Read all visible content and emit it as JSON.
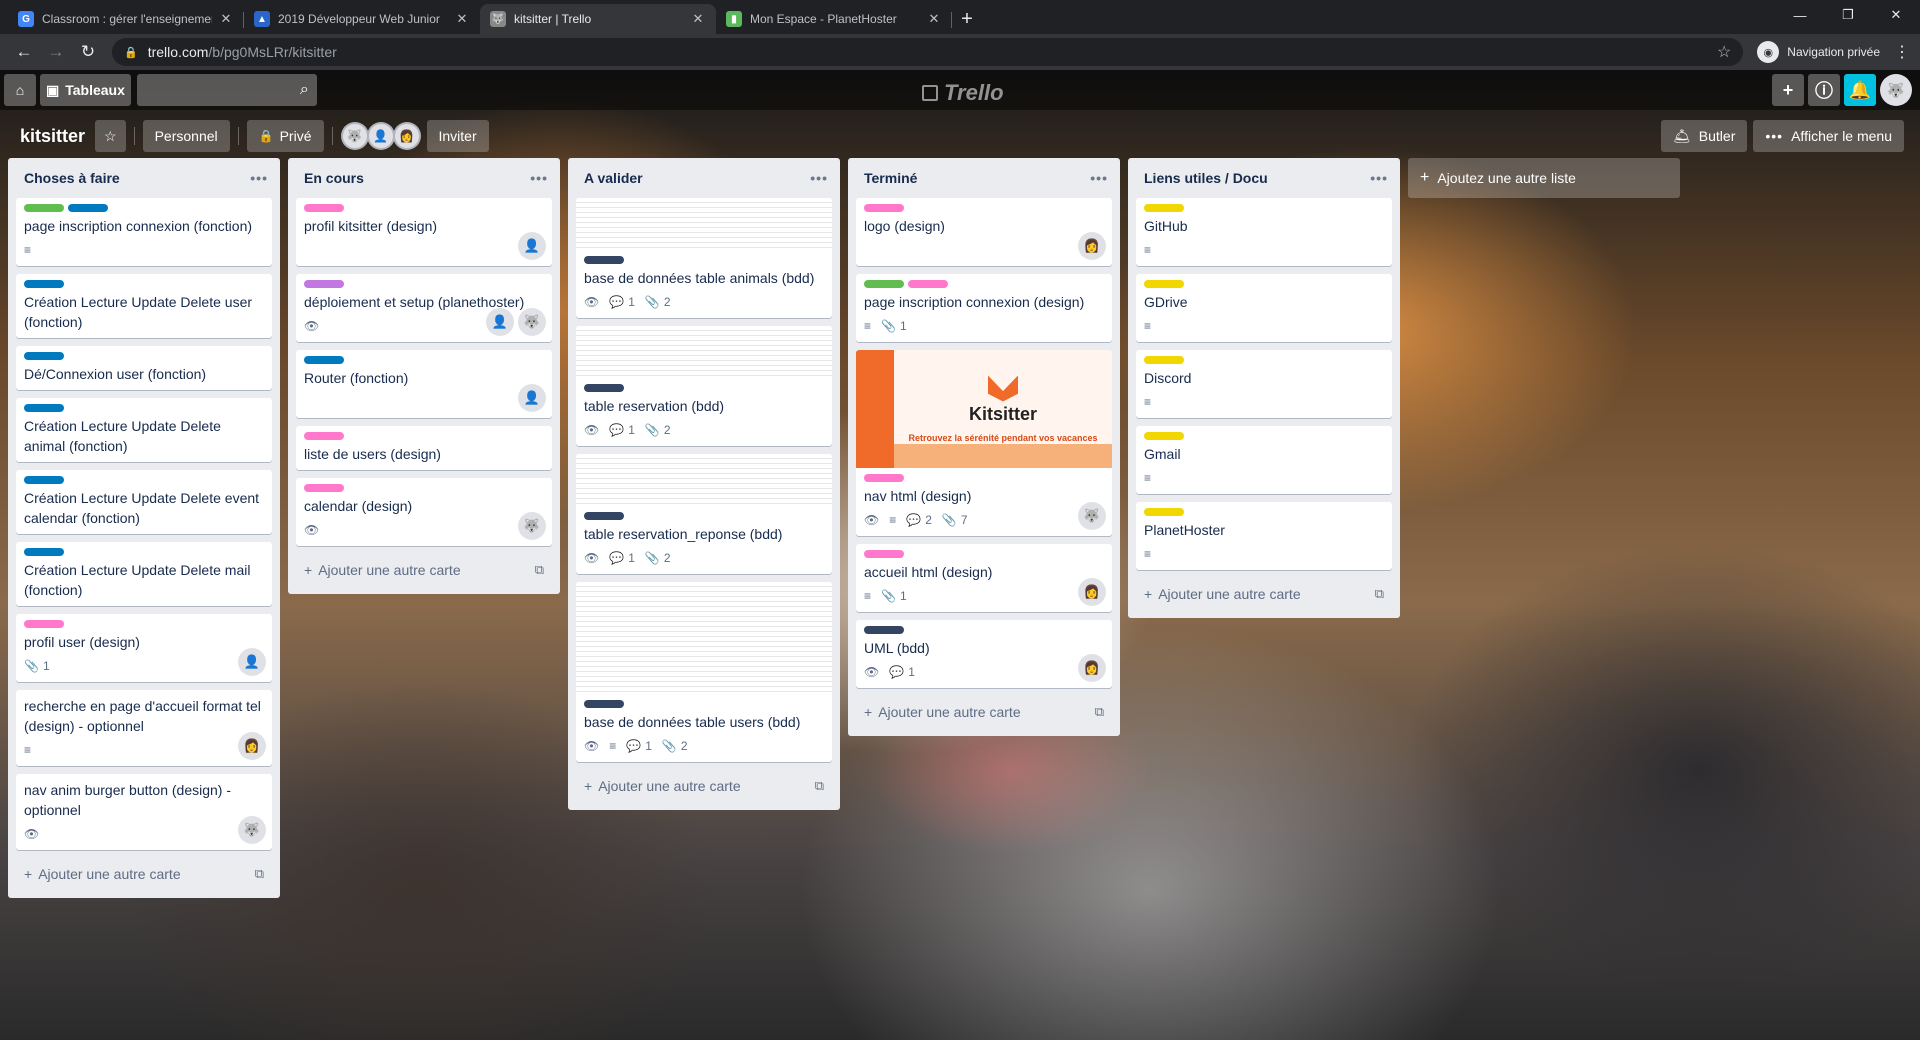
{
  "browser": {
    "tabs": [
      {
        "title": "Classroom : gérer l'enseignement",
        "favicon": "G",
        "color": "#4285f4"
      },
      {
        "title": "2019 Développeur Web Junior",
        "favicon": "▲",
        "color": "#2a66c9"
      },
      {
        "title": "kitsitter | Trello",
        "favicon": "🐺",
        "color": "#888888"
      },
      {
        "title": "Mon Espace - PlanetHoster",
        "favicon": "▮",
        "color": "#5cb85c"
      }
    ],
    "url_host": "trello.com",
    "url_path": "/b/pg0MsLRr/kitsitter",
    "profile_label": "Navigation privée"
  },
  "trello_header": {
    "boards_label": "Tableaux",
    "logo": "Trello"
  },
  "board": {
    "title": "kitsitter",
    "team_label": "Personnel",
    "visibility_label": "Privé",
    "invite_label": "Inviter",
    "butler_label": "Butler",
    "menu_label": "Afficher le menu",
    "add_list_label": "Ajoutez une autre liste",
    "add_card_label": "Ajouter une autre carte"
  },
  "lists": [
    {
      "title": "Choses à faire",
      "cards": [
        {
          "title": "page inscription connexion (fonction)",
          "labels": [
            "green",
            "blue"
          ],
          "desc": true
        },
        {
          "title": "Création Lecture Update Delete user (fonction)",
          "labels": [
            "blue"
          ]
        },
        {
          "title": "Dé/Connexion user (fonction)",
          "labels": [
            "blue"
          ]
        },
        {
          "title": "Création Lecture Update Delete animal (fonction)",
          "labels": [
            "blue"
          ]
        },
        {
          "title": "Création Lecture Update Delete event calendar (fonction)",
          "labels": [
            "blue"
          ]
        },
        {
          "title": "Création Lecture Update Delete mail (fonction)",
          "labels": [
            "blue"
          ]
        },
        {
          "title": "profil user (design)",
          "labels": [
            "pink"
          ],
          "attach": "1",
          "avatar": "👤"
        },
        {
          "title": "recherche en page d'accueil format tel (design) - optionnel",
          "labels": [],
          "desc": true,
          "avatar": "👩"
        },
        {
          "title": "nav anim burger button (design) - optionnel",
          "labels": [],
          "watch": true,
          "avatar": "🐺"
        }
      ]
    },
    {
      "title": "En cours",
      "cards": [
        {
          "title": "profil kitsitter (design)",
          "labels": [
            "pink"
          ],
          "avatar": "👤"
        },
        {
          "title": "déploiement et setup (planethoster)",
          "labels": [
            "purple"
          ],
          "watch": true,
          "avatar": "👤",
          "avatar2": "🐺"
        },
        {
          "title": "Router (fonction)",
          "labels": [
            "blue"
          ],
          "avatar": "👤"
        },
        {
          "title": "liste de users (design)",
          "labels": [
            "pink"
          ]
        },
        {
          "title": "calendar (design)",
          "labels": [
            "pink"
          ],
          "watch": true,
          "avatar": "🐺"
        }
      ]
    },
    {
      "title": "A valider",
      "cards": [
        {
          "title": "base de données table animals (bdd)",
          "labels": [
            "navy"
          ],
          "thumb": "short",
          "watch": true,
          "comments": "1",
          "attach": "2"
        },
        {
          "title": "table reservation (bdd)",
          "labels": [
            "navy"
          ],
          "thumb": "short",
          "watch": true,
          "comments": "1",
          "attach": "2"
        },
        {
          "title": "table reservation_reponse (bdd)",
          "labels": [
            "navy"
          ],
          "thumb": "short",
          "watch": true,
          "comments": "1",
          "attach": "2"
        },
        {
          "title": "base de données table users (bdd)",
          "labels": [
            "navy"
          ],
          "thumb": "tall",
          "watch": true,
          "desc": true,
          "comments": "1",
          "attach": "2"
        }
      ]
    },
    {
      "title": "Terminé",
      "cards": [
        {
          "title": "logo (design)",
          "labels": [
            "pink"
          ],
          "avatar": "👩"
        },
        {
          "title": "page inscription connexion (design)",
          "labels": [
            "green",
            "pink"
          ],
          "desc": true,
          "attach": "1"
        },
        {
          "title": "nav html (design)",
          "labels": [
            "pink"
          ],
          "cover": true,
          "watch": true,
          "desc": true,
          "comments": "2",
          "attach": "7",
          "avatar": "🐺"
        },
        {
          "title": "accueil html (design)",
          "labels": [
            "pink"
          ],
          "desc": true,
          "attach": "1",
          "avatar": "👩"
        },
        {
          "title": "UML (bdd)",
          "labels": [
            "navy"
          ],
          "watch": true,
          "comments": "1",
          "avatar": "👩"
        }
      ]
    },
    {
      "title": "Liens utiles / Docu",
      "cards": [
        {
          "title": "GitHub",
          "labels": [
            "yellow"
          ],
          "desc": true
        },
        {
          "title": "GDrive",
          "labels": [
            "yellow"
          ],
          "desc": true
        },
        {
          "title": "Discord",
          "labels": [
            "yellow"
          ],
          "desc": true
        },
        {
          "title": "Gmail",
          "labels": [
            "yellow"
          ],
          "desc": true
        },
        {
          "title": "PlanetHoster",
          "labels": [
            "yellow"
          ],
          "desc": true
        }
      ]
    }
  ],
  "cover_image": {
    "logo_text": "Kitsitter",
    "tagline": "Retrouvez la sérénité pendant vos vacances"
  }
}
